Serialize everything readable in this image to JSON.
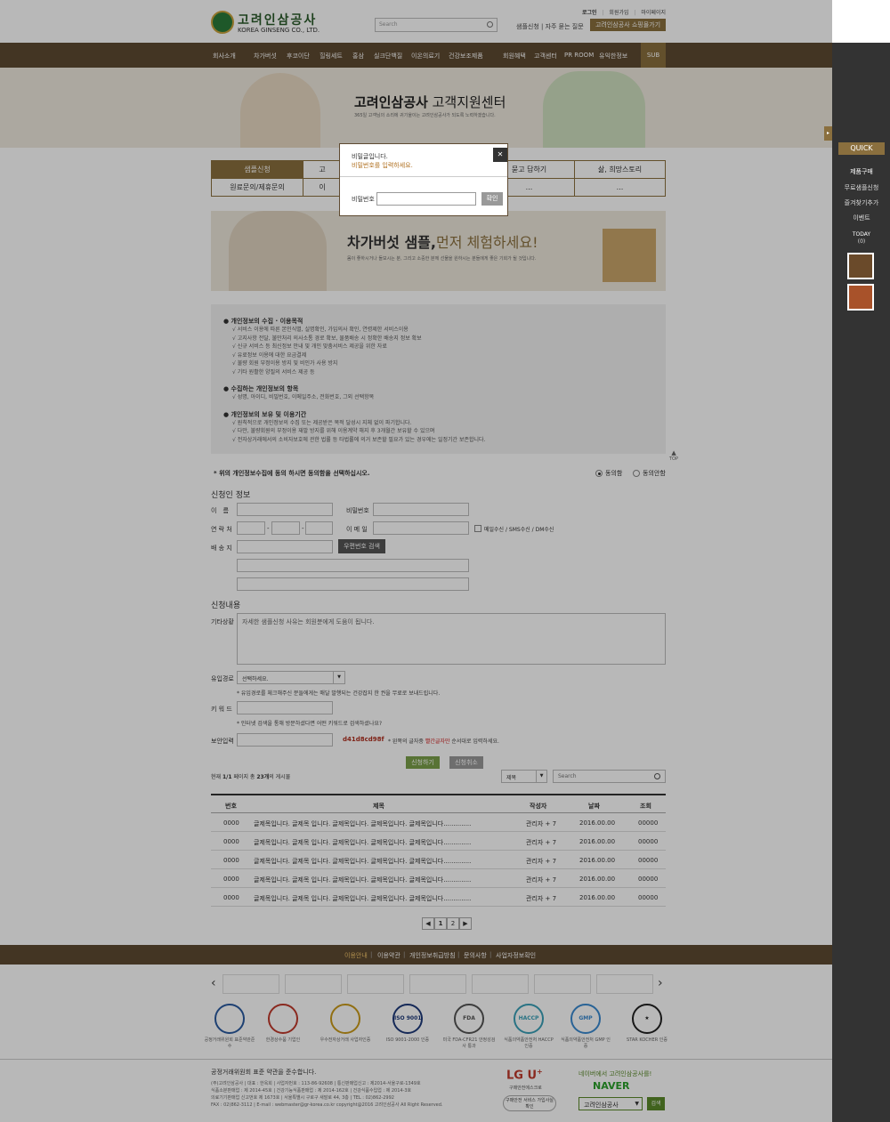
{
  "header": {
    "logo_kr": "고려인삼공사",
    "logo_en": "KOREA GINSENG CO., LTD.",
    "search_placeholder": "Search",
    "top_links": [
      "로그인",
      "회원가입",
      "마이페이지"
    ],
    "faq_links": "샘플신청 | 자주 묻는 질문",
    "shop_button": "고려인삼공사 쇼핑몰가기"
  },
  "nav": {
    "items": [
      "회사소개",
      "차가버섯",
      "후코이단",
      "힐링세트",
      "홍삼",
      "실크단백질",
      "이온의료기",
      "건강보조제품",
      "회원혜택",
      "고객센터",
      "PR ROOM",
      "유익한정보"
    ],
    "sub_button": "SUB"
  },
  "hero": {
    "title_brand": "고려인삼공사",
    "title_rest": "고객지원센터",
    "subtitle": "365일 고객님의 소리에 귀기울이는 고려인삼공사가 되도록 노력하겠습니다."
  },
  "quick": {
    "arrow": "▸",
    "title": "QUICK",
    "items": [
      "제품구매",
      "무료샘플신청",
      "즐겨찾기추가",
      "이벤트"
    ],
    "today_label": "TODAY",
    "today_count": "(0)"
  },
  "tabs": {
    "row1": [
      "샘플신청",
      "고",
      "묻고 답하기",
      "삶, 희망스토리"
    ],
    "row2": [
      "원료문의/제휴문의",
      "이",
      "...",
      "..."
    ]
  },
  "banner": {
    "title_main": "차가버섯 샘플,",
    "title_accent": "먼저 체험하세요!",
    "desc": "몸이 좋하시거나 돌보시는 분, 그리고 소중한 분께 선물을 원하시는 분들에게 좋은 기회가 될 것입니다."
  },
  "privacy": {
    "sections": [
      {
        "title": "● 개인정보의 수집 · 이용목적",
        "lines": [
          "√ 서비스 이용에 따른 본인식별, 실명확인, 가입의사 확인, 연령제한 서비스이용",
          "√ 고지사항 전달, 불만처리 의사소통 경로 확보, 물품배송 시 정확한 배송지 정보 확보",
          "√ 신규 서비스 등 최신정보 안내 및 개인 맞춤서비스 제공을 위한 자료",
          "√ 유료정보 이용에 대한 요금결제",
          "√ 불량 회원 부정이용 방지 및 비인가 사용 방지",
          "√ 기타 원활한 양질의 서비스 제공 등"
        ]
      },
      {
        "title": "● 수집하는 개인정보의 항목",
        "lines": [
          "√ 성명, 아이디, 비밀번호, 이메일주소, 전화번호, 그외 선택항목"
        ]
      },
      {
        "title": "● 개인정보의 보유 및 이용기간",
        "lines": [
          "√ 원칙적으로 개인정보의 수집 또는 제공받은 목적 달성시 지체 없이 파기합니다.",
          "√ 다만, 불량회원의 부정이용 재발 방지를 위해 이용계약 해지 후 3개월간 보유할 수 있으며",
          "√ 전자상거래에서의 소비자보호에 관한 법률 등 타법률에 의거 보존할 필요가 있는 경우에는 일정기간 보존합니다."
        ]
      }
    ]
  },
  "top_button": "TOP",
  "agree": {
    "question": "* 위의 개인정보수집에 동의 하시면 동의함을 선택하십시오.",
    "yes": "동의함",
    "no": "동의안함"
  },
  "applicant": {
    "heading": "신청인 정보",
    "name_label": "이　름",
    "password_label": "비밀번호",
    "phone_label": "연 락 처",
    "phone_sep": "-",
    "email_label": "이 메 일",
    "email_consent": "메일수신 / SMS수신 / DM수신",
    "address_label": "배 송 지",
    "zip_button": "우편번호 검색"
  },
  "content": {
    "heading": "신청내용",
    "etc_label": "기타상황",
    "etc_placeholder": "자세한 샘플신청 사유는 회원분에게 도움이 됩니다.",
    "route_label": "유입경로",
    "route_value": "선택하세요.",
    "route_note": "* 유입경로를 체크해주신 분들에게는 매달 발행되는 건강잡지 한 권을 무료로 보내드립니다.",
    "keyword_label": "키 워 드",
    "keyword_note": "* 인터넷 검색을 통해 방문하셨다면 어떤 키워드로 검색하셨나요?",
    "captcha_label": "보안입력",
    "captcha_code": "d41d8cd98f",
    "captcha_note_pre": "* 왼쪽의 글자중",
    "captcha_note_red": "빨간글자만",
    "captcha_note_post": "순서대로 입력하세요.",
    "submit": "신청하기",
    "cancel": "신청취소"
  },
  "list": {
    "summary_pre": "현재",
    "page": "1/1",
    "summary_mid": "페이지 총",
    "total": "23개",
    "summary_post": "의 게시물",
    "filter_value": "제목",
    "search_placeholder": "Search",
    "columns": [
      "번호",
      "제목",
      "작성자",
      "날짜",
      "조회"
    ],
    "rows": [
      [
        "0000",
        "글제목입니다. 글제목 입니다. 글제목입니다. 글제목입니다. 글제목입니다..............",
        "관리자 + 7",
        "2016.00.00",
        "00000"
      ],
      [
        "0000",
        "글제목입니다. 글제목 입니다. 글제목입니다. 글제목입니다. 글제목입니다..............",
        "관리자 + 7",
        "2016.00.00",
        "00000"
      ],
      [
        "0000",
        "글제목입니다. 글제목 입니다. 글제목입니다. 글제목입니다. 글제목입니다..............",
        "관리자 + 7",
        "2016.00.00",
        "00000"
      ],
      [
        "0000",
        "글제목입니다. 글제목 입니다. 글제목입니다. 글제목입니다. 글제목입니다..............",
        "관리자 + 7",
        "2016.00.00",
        "00000"
      ],
      [
        "0000",
        "글제목입니다. 글제목 입니다. 글제목입니다. 글제목입니다. 글제목입니다..............",
        "관리자 + 7",
        "2016.00.00",
        "00000"
      ]
    ],
    "pages": [
      "◀",
      "1",
      "2",
      "▶"
    ]
  },
  "footer_nav": [
    "이용안내",
    "이용약관",
    "개인정보취급방침",
    "문의사항",
    "사업자정보확인"
  ],
  "partners_arrows": [
    "‹",
    "›"
  ],
  "certs": [
    {
      "text": "공정거래위원회 표준약관준수",
      "color": "#2a5aa0"
    },
    {
      "text": "한경상수품 기업인",
      "color": "#c0392b"
    },
    {
      "text": "우수전자상거래 사업자인증",
      "color": "#c99a1a"
    },
    {
      "text": "ISO 9001-2000 인증",
      "color": "#1e3a7a",
      "badge": "ISO 9001: 2000"
    },
    {
      "text": "미국 FDA-CFR21 안정성검사 통과",
      "color": "#555",
      "badge": "FDA"
    },
    {
      "text": "식품의약품안전처 HACCP 인증",
      "color": "#3aa0b8",
      "badge": "HACCP"
    },
    {
      "text": "식품의약품안전처 GMP 인증",
      "color": "#3a8ad0",
      "badge": "GMP"
    },
    {
      "text": "STAR KOCHER 인증",
      "color": "#222",
      "badge": "★"
    }
  ],
  "footer": {
    "title": "공정거래위원회 표준 약관을 준수합니다.",
    "lines": [
      "(주)고려인삼공사 | 대표 : 한옥희 | 사업자번호 : 113-86-92608 | 통신판매업신고 : 제2014-서울구로-1349호",
      "식품소분판매업 : 제 2014-45호 | 건강기능식품판매업 : 제 2014-162호 | 건강식품수입업 : 제 2014-3호",
      "의료기기판매업 신고번호 제 1673호 | 서울특별시 구로구 새말로 44, 3층 | TEL : 02)862-2992",
      "FAX : 02)862-3112 | E-mail : webmaster@gr-korea.co.kr  copyright@2016 고려인삼공사 All Right Reserved."
    ],
    "lgu_logo": "LG U",
    "lgu_plus": "+",
    "lgu_text": "구매안전에스크로",
    "lgu_btn": "구매안전 서비스 가입사실 확인",
    "naver_slogan": "네이버에서 고려인삼공사를!",
    "naver_logo": "NAVER",
    "naver_select": "고려인삼공사",
    "naver_btn": "검색"
  },
  "modal": {
    "title": "비밀글입니다.",
    "subtitle": "비밀번호를 입력하세요.",
    "close": "✕",
    "password_label": "비밀번호",
    "confirm": "확인"
  }
}
